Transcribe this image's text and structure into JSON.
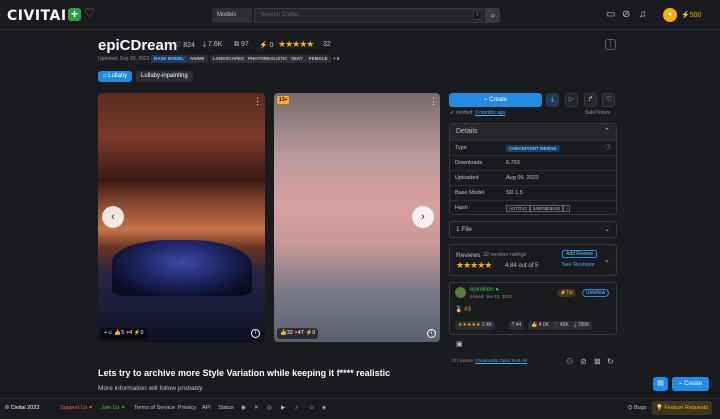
{
  "header": {
    "logo_left": "CIVIT",
    "logo_right": "AI",
    "search_type": "Models",
    "search_placeholder": "Search Civitai",
    "slash": "/",
    "buzz": "500"
  },
  "model": {
    "title": "epiCDream",
    "likes": "824",
    "downloads": "7.6K",
    "collections": "97",
    "buzz": "0",
    "rating_count": "32",
    "updated": "Updated: Sep 29, 2023",
    "base_tag": "BASE MODEL",
    "tags": [
      "ANIME",
      "LANDSCAPES",
      "PHOTOREALISTIC",
      "SEXY",
      "FEMALE",
      "+ 6"
    ],
    "versions": [
      "Lullaby",
      "Lullaby-inpainting"
    ]
  },
  "images": {
    "img1_reactions": [
      "5",
      "4",
      "0"
    ],
    "img2_badge": "13+",
    "img2_reactions": [
      "32",
      "47",
      "0"
    ]
  },
  "description": {
    "title": "Lets try to archive more Style Variation while keeping it f**** realistic",
    "sub": "More information will follow ",
    "sub_italic": "probably"
  },
  "panel": {
    "create": "Create",
    "verified": "Verified: ",
    "verified_when": "3 months ago",
    "safe": "SafeTensor",
    "details_title": "Details",
    "details": {
      "type_k": "Type",
      "type_v": "CHECKPOINT MERGE",
      "dl_k": "Downloads",
      "dl_v": "6,793",
      "up_k": "Uploaded",
      "up_v": "Aug 09, 2023",
      "bm_k": "Base Model",
      "bm_v": "SD 1.5",
      "hash_k": "Hash",
      "hash_t": "AUTOV2",
      "hash_v": "546F883EAD"
    },
    "files": "1 File",
    "reviews": {
      "title": "Reviews",
      "count": "32 version ratings",
      "out": "4.84 out of 5",
      "add": "Add Review",
      "see": "See Reviews"
    },
    "creator": {
      "name": "epinikion",
      "joined": "Joined: Jan 10, 2023",
      "tip": "Tip",
      "unfollow": "Unfollow",
      "rank": "#3",
      "s1": "2.4K",
      "s2": "44",
      "s3": "4.0K",
      "s4": "45K",
      "s5": "785K"
    },
    "license": "License: ",
    "license_v": "CreativeML Open RAIL-M"
  },
  "footer": {
    "copy": "© Civitai 2023",
    "support": "Support Us",
    "join": "Join Us",
    "terms": "Terms of Service",
    "privacy": "Privacy",
    "api": "API",
    "status": "Status",
    "bugs": "Bugs",
    "feature": "Feature Requests",
    "create": "Create"
  },
  "colors": {
    "accent": "#228be6",
    "star": "#fab005",
    "bg": "#1a1b1e"
  }
}
